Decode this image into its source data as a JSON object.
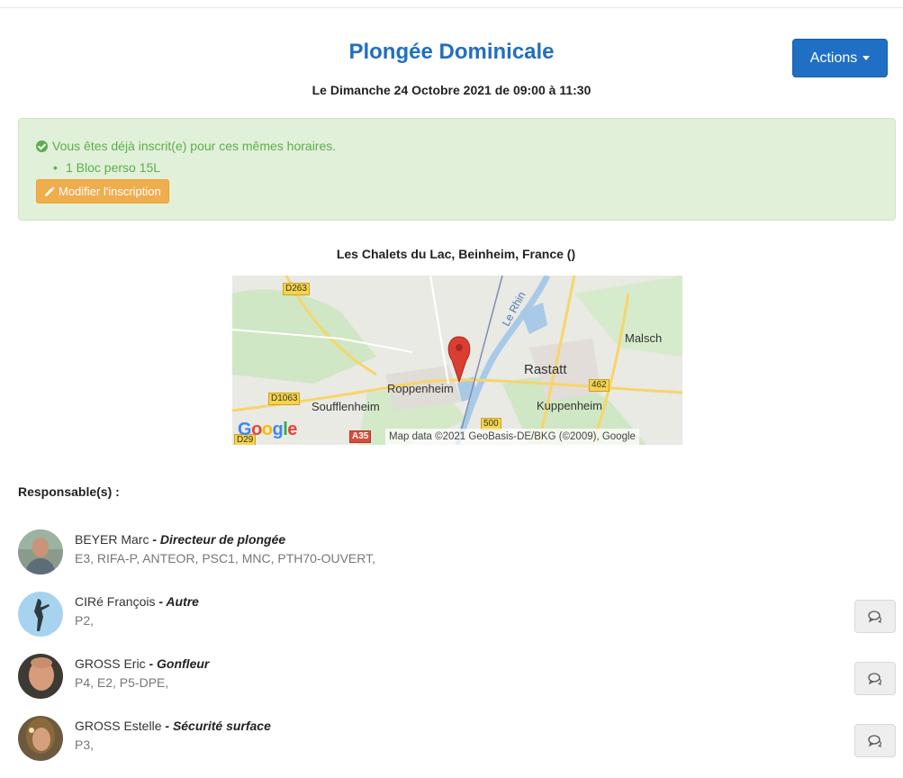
{
  "event": {
    "title": "Plongée Dominicale",
    "date_prefix": "Le Dimanche",
    "date_strong": "24 Octobre 2021",
    "date_suffix": "de 09:00 à 11:30"
  },
  "actions_button": {
    "label": "Actions"
  },
  "alert": {
    "message": "Vous êtes déjà inscrit(e) pour ces mêmes horaires.",
    "items": [
      "1 Bloc perso 15L"
    ],
    "modify_label": "Modifier l'inscription",
    "color": "#5cae4d"
  },
  "location": {
    "title": "Les Chalets du Lac, Beinheim, France ()"
  },
  "map": {
    "places": [
      "Malsch",
      "Rastatt",
      "Roppenheim",
      "Soufflenheim",
      "Kuppenheim",
      "Le Rhin"
    ],
    "roads": [
      "D263",
      "D1063",
      "462",
      "500",
      "A35",
      "D29"
    ],
    "logo": "Google",
    "attribution": "Map data ©2021 GeoBasis-DE/BKG (©2009), Google"
  },
  "responsables": {
    "title": "Responsable(s) :",
    "people": [
      {
        "name": "BEYER Marc",
        "role": "Directeur de plongée",
        "quals": "E3, RIFA-P, ANTEOR, PSC1, MNC, PTH70-OUVERT,"
      },
      {
        "name": "CIRé François",
        "role": "Autre",
        "quals": "P2,"
      },
      {
        "name": "GROSS Eric",
        "role": "Gonfleur",
        "quals": "P4, E2, P5-DPE,"
      },
      {
        "name": "GROSS Estelle",
        "role": "Sécurité surface",
        "quals": "P3,"
      }
    ]
  },
  "colors": {
    "primary": "#1f6fc5",
    "title": "#2170c0",
    "warning": "#f0ad4e",
    "success_bg": "#e1f0d8"
  }
}
